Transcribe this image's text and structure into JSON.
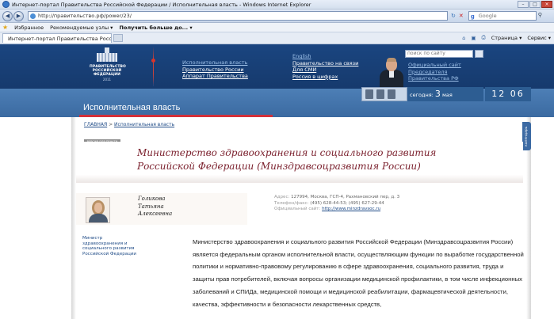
{
  "browser": {
    "window_title": "Интернет-портал Правительства Российской Федерации / Исполнительная власть - Windows Internet Explorer",
    "address": "http://правительство.рф/power/23/",
    "search_placeholder": "Google",
    "favorites_label": "Избранное",
    "fav_links": [
      "Рекомендуемые узлы ▾",
      "Получить больше до... ▾"
    ],
    "tab_title": "Интернет-портал Правительства Российской ...",
    "toolbar_right": [
      "Страница ▾",
      "Сервис ▾"
    ]
  },
  "header": {
    "emblem_lines": [
      "ПРАВИТЕЛЬСТВО",
      "РОССИЙСКОЙ",
      "ФЕДЕРАЦИИ"
    ],
    "emblem_year": "2011",
    "nav_col1": [
      "Исполнительная власть",
      "Правительство России",
      "Аппарат Правительства"
    ],
    "nav_col2": [
      "English",
      "Правительство на связи",
      "Для СМИ",
      "Россия в цифрах"
    ],
    "site_search_placeholder": "поиск по сайту",
    "pm_links": [
      "Официальный сайт",
      "Председателя",
      "Правительства РФ"
    ],
    "section_title": "Исполнительная власть",
    "date_label": "сегодня:",
    "date_day": "3",
    "date_month": "мая",
    "time": "12 06",
    "side_tab": "календарь"
  },
  "breadcrumb": {
    "home": "ГЛАВНАЯ",
    "sep": " > ",
    "current": "Исполнительная власть"
  },
  "print_label": "ВЕРСИЯ ДЛЯ ПЕЧАТИ",
  "ministry": {
    "title": "Министерство здравоохранения и социального развития Российской Федерации (Минздравсоцразвития России)",
    "minister_lines": [
      "Голикова",
      "Татьяна",
      "Алексеевна"
    ],
    "address_label": "Адрес:",
    "address_value": "127994, Москва, ГСП-4, Рахмановский пер, д. 3",
    "phone_label": "Телефон/факс:",
    "phone_value": "(495) 628-44-53; (495) 627-29-44",
    "site_label": "Официальный сайт:",
    "site_value": "http://www.minzdravsoc.ru",
    "side_link": "Министр здравоохранения и социального развития Российской Федерации",
    "description": "Министерство здравоохранения и социального развития Российской Федерации (Минздравсоцразвития России) является федеральным органом исполнительной власти, осуществляющим функции по выработке государственной политики и нормативно-правовому регулированию в сфере здравоохранения, социального развития, труда и защиты прав потребителей, включая вопросы организации медицинской профилактики, в том числе инфекционных заболеваний и СПИДа, медицинской помощи и медицинской реабилитации, фармацевтической деятельности, качества, эффективности и безопасности лекарственных средств,"
  }
}
